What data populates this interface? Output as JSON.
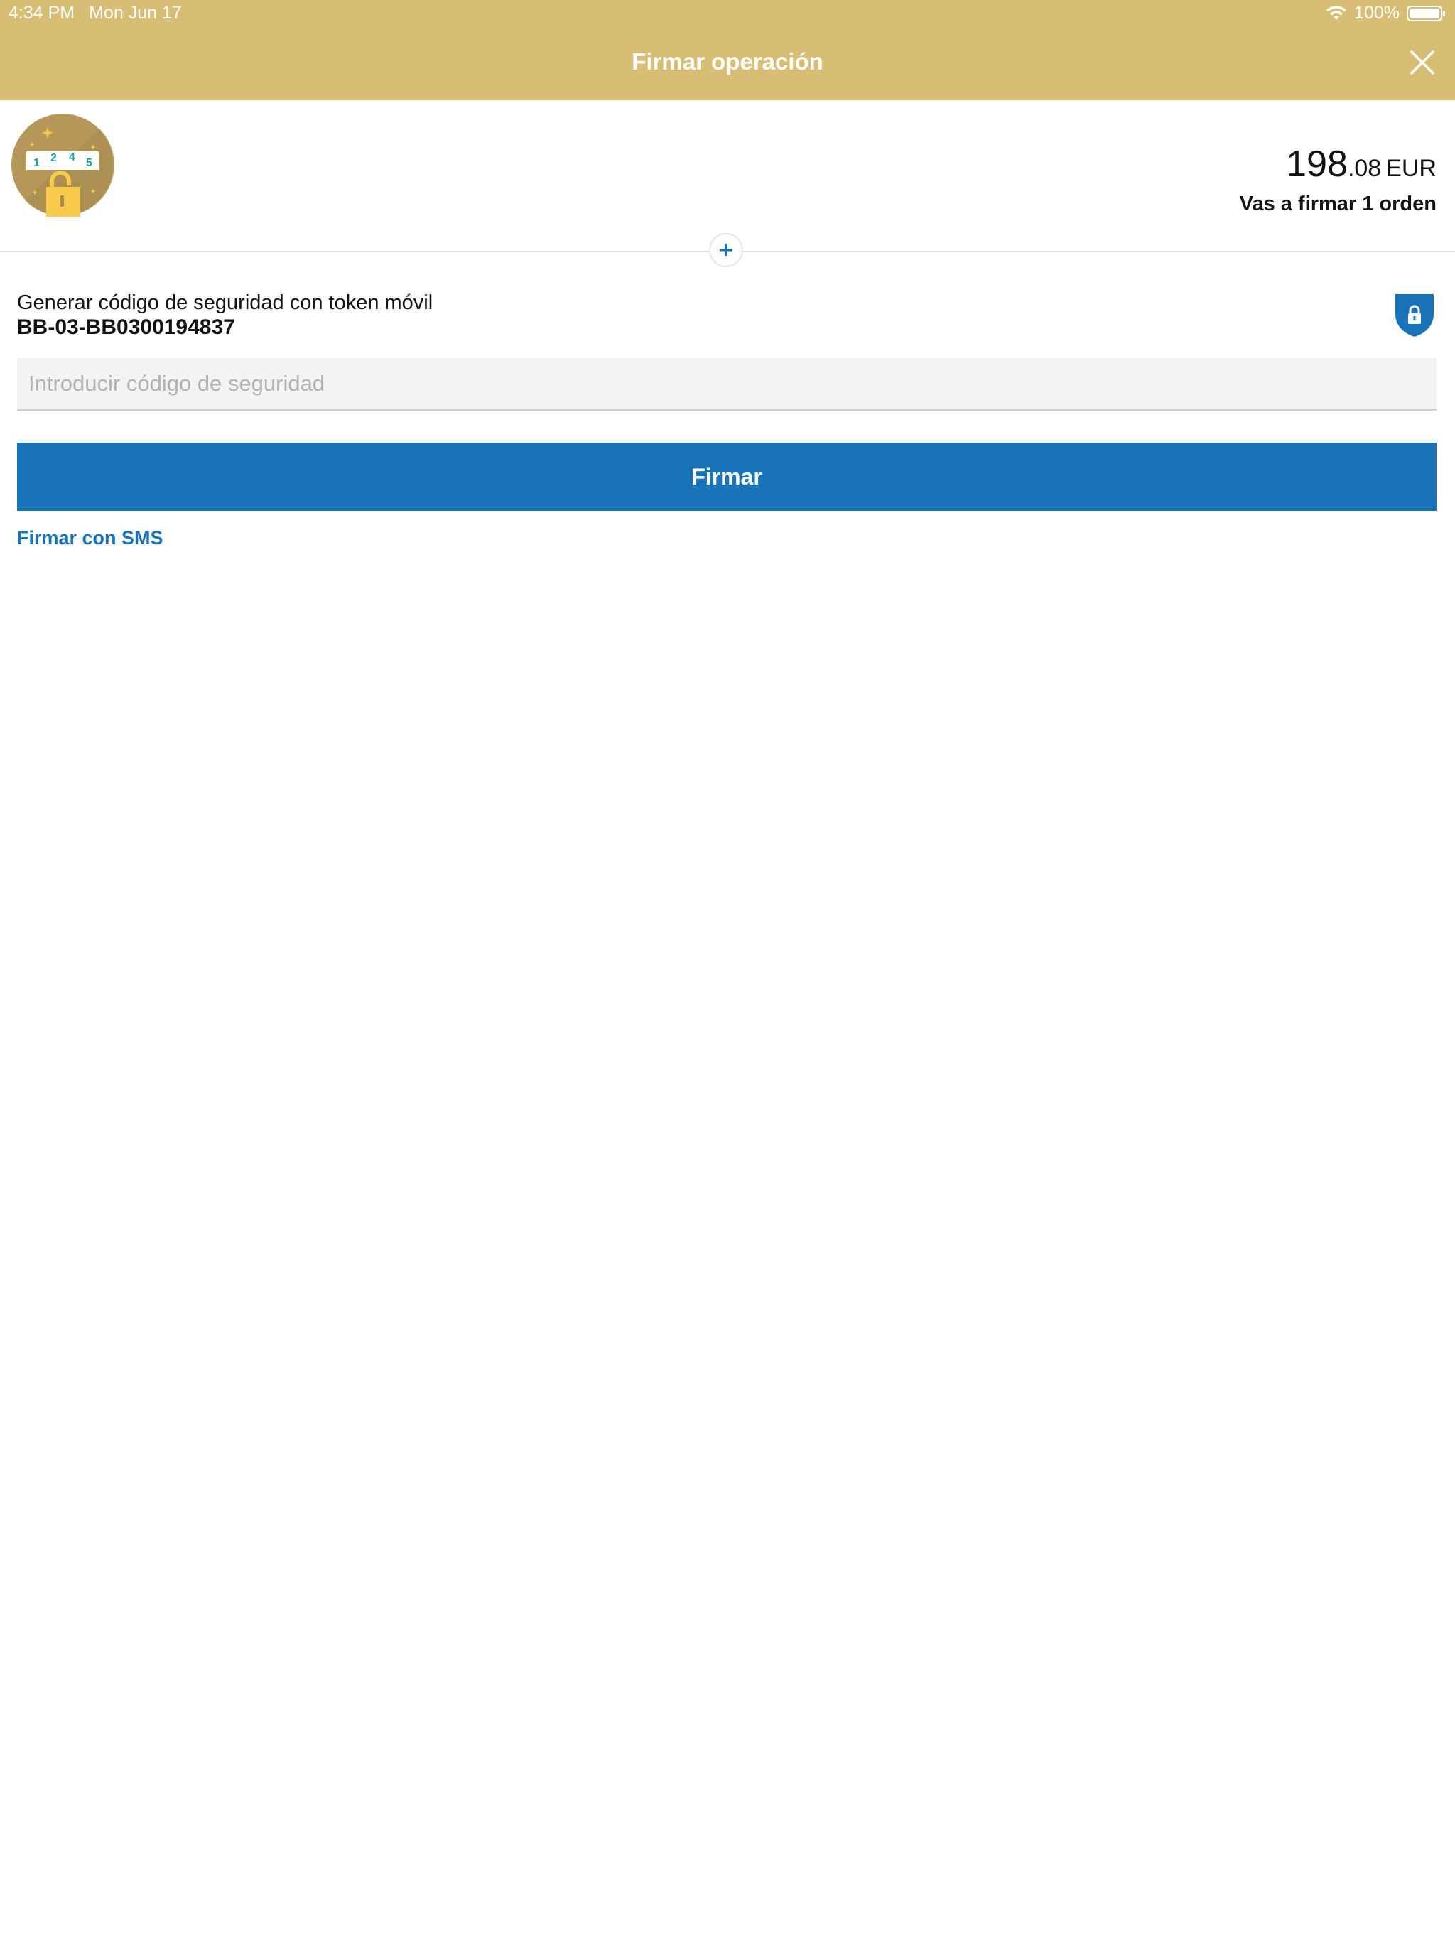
{
  "status_bar": {
    "time": "4:34 PM",
    "date": "Mon Jun 17",
    "battery": "100%",
    "wifi_icon": "wifi-icon",
    "battery_icon": "battery-icon"
  },
  "nav": {
    "title": "Firmar operación",
    "close_icon": "close-icon"
  },
  "summary": {
    "illustration_digits": [
      "1",
      "2",
      "4",
      "5"
    ],
    "amount_integer": "198",
    "amount_decimal": ".08",
    "currency": "EUR",
    "order_text": "Vas a firmar 1 orden",
    "expand_icon": "plus-icon"
  },
  "token": {
    "label": "Generar código de seguridad con token móvil",
    "id": "BB-03-BB0300194837",
    "icon": "shield-lock-icon"
  },
  "form": {
    "code_placeholder": "Introducir código de seguridad",
    "code_value": "",
    "sign_label": "Firmar",
    "sms_label": "Firmar con SMS"
  },
  "colors": {
    "header_bg": "#d8bd74",
    "primary_blue": "#1973b8",
    "illustration_circle": "#b5985a",
    "lock_yellow": "#f8c94a",
    "digit_teal": "#1aa3a3"
  }
}
